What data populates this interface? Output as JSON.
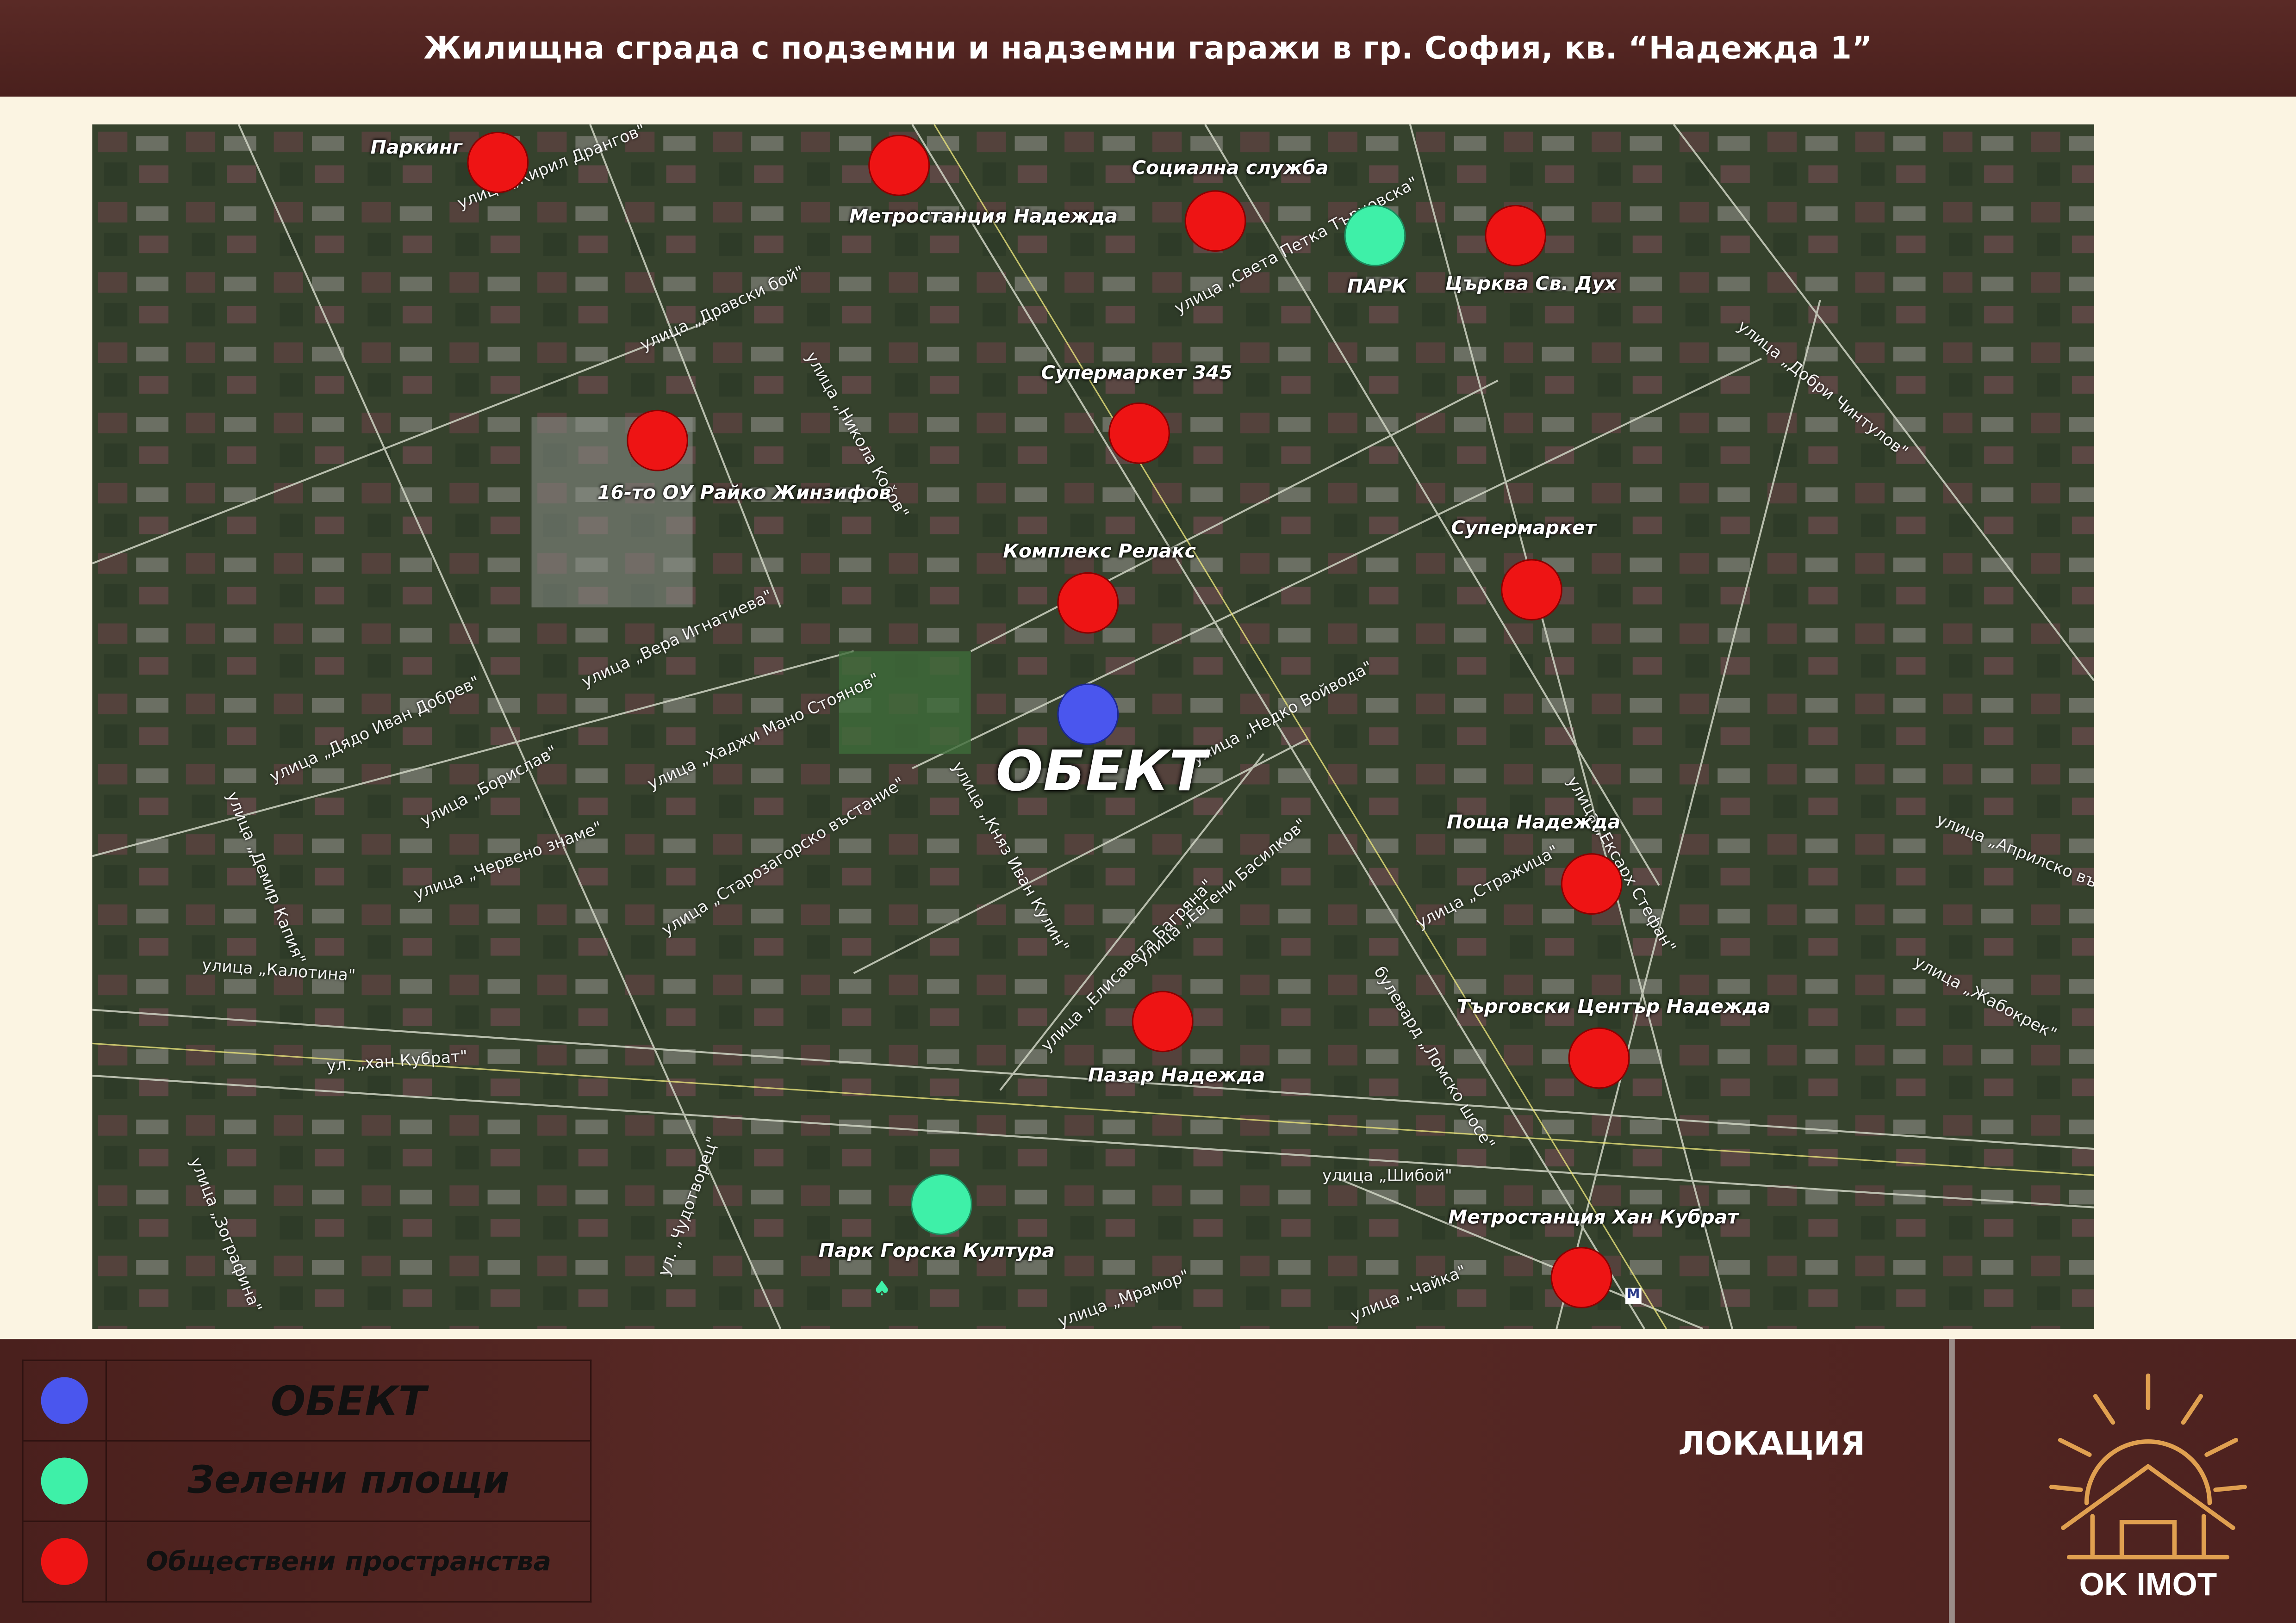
{
  "title": "Жилищна  сграда с подземни и надземни гаражи  в гр.  София, кв. “Надежда 1”",
  "map": {
    "object_label": "ОБЕКТ",
    "points": [
      {
        "id": "parking",
        "label": "Паркинг",
        "type": "public"
      },
      {
        "id": "metro-nadezhda",
        "label": "Метростанция Надежда",
        "type": "public"
      },
      {
        "id": "social-service",
        "label": "Социална служба",
        "type": "public"
      },
      {
        "id": "park",
        "label": "ПАРК",
        "type": "green"
      },
      {
        "id": "church",
        "label": "Църква Св. Дух",
        "type": "public"
      },
      {
        "id": "supermarket-345",
        "label": "Супермаркет 345",
        "type": "public"
      },
      {
        "id": "school",
        "label": "16-то ОУ Райко Жинзифов",
        "type": "public"
      },
      {
        "id": "complex-relax",
        "label": "Комплекс Релакс",
        "type": "public"
      },
      {
        "id": "supermarket",
        "label": "Супермаркет",
        "type": "public"
      },
      {
        "id": "object",
        "label": "",
        "type": "object"
      },
      {
        "id": "post",
        "label": "Поща Надежда",
        "type": "public"
      },
      {
        "id": "market",
        "label": "Пазар Надежда",
        "type": "public"
      },
      {
        "id": "shopping-center",
        "label": "Търговски Център Надежда",
        "type": "public"
      },
      {
        "id": "park-gorska",
        "label": "Парк Горска Култура",
        "type": "green"
      },
      {
        "id": "metro-han-kubrat",
        "label": "Метростанция Хан Кубрат",
        "type": "public"
      }
    ],
    "streets": [
      "улица „Кирил Дрангов\"",
      "улица „Дравски бой\"",
      "улица „Никола Коčов\"",
      "улица „Света Петка Търновска\"",
      "улица „Добри Чинтулов\"",
      "улица „Вера Игнатиева\"",
      "улица „Хаджи Мано Стоянов\"",
      "улица „Дядо Иван Добрев\"",
      "улица „Борислав\"",
      "улица „Червено знаме\"",
      "улица „Демир Капия\"",
      "улица „Калотина\"",
      "улица „Старозагорско въстание\"",
      "улица „Княз Иван Кулин\"",
      "улица „Недко Войвода\"",
      "улица „Стражица\"",
      "улица „Ексарх Стефан\"",
      "улица „Априлско въстание\"",
      "улица „Жабокрек\"",
      "ул. „хан Кубрат\"",
      "улица „Зографина\"",
      "ул. „Чудотворец\"",
      "улица „Шибой\"",
      "улица „Чайка\"",
      "улица „Мрамор\"",
      "улица „Елисавета Багряна\"",
      "улица „Евгени Басилков\"",
      "булевард „Ломско шосе\""
    ]
  },
  "legend": [
    {
      "label": "ОБЕКТ",
      "color": "#4a56ee"
    },
    {
      "label": "Зелени площи",
      "color": "#3ef0a8"
    },
    {
      "label": "Обществени пространства",
      "color": "#ee1414"
    }
  ],
  "section_label": "ЛОКАЦИЯ",
  "logo": {
    "text": "OK IMOT"
  },
  "colors": {
    "header_bg": "#4e2320",
    "page_bg": "#fbf4e2",
    "public": "#ee1414",
    "green": "#3ef0a8",
    "object": "#4a56ee",
    "logo_orange": "#e0a050"
  }
}
